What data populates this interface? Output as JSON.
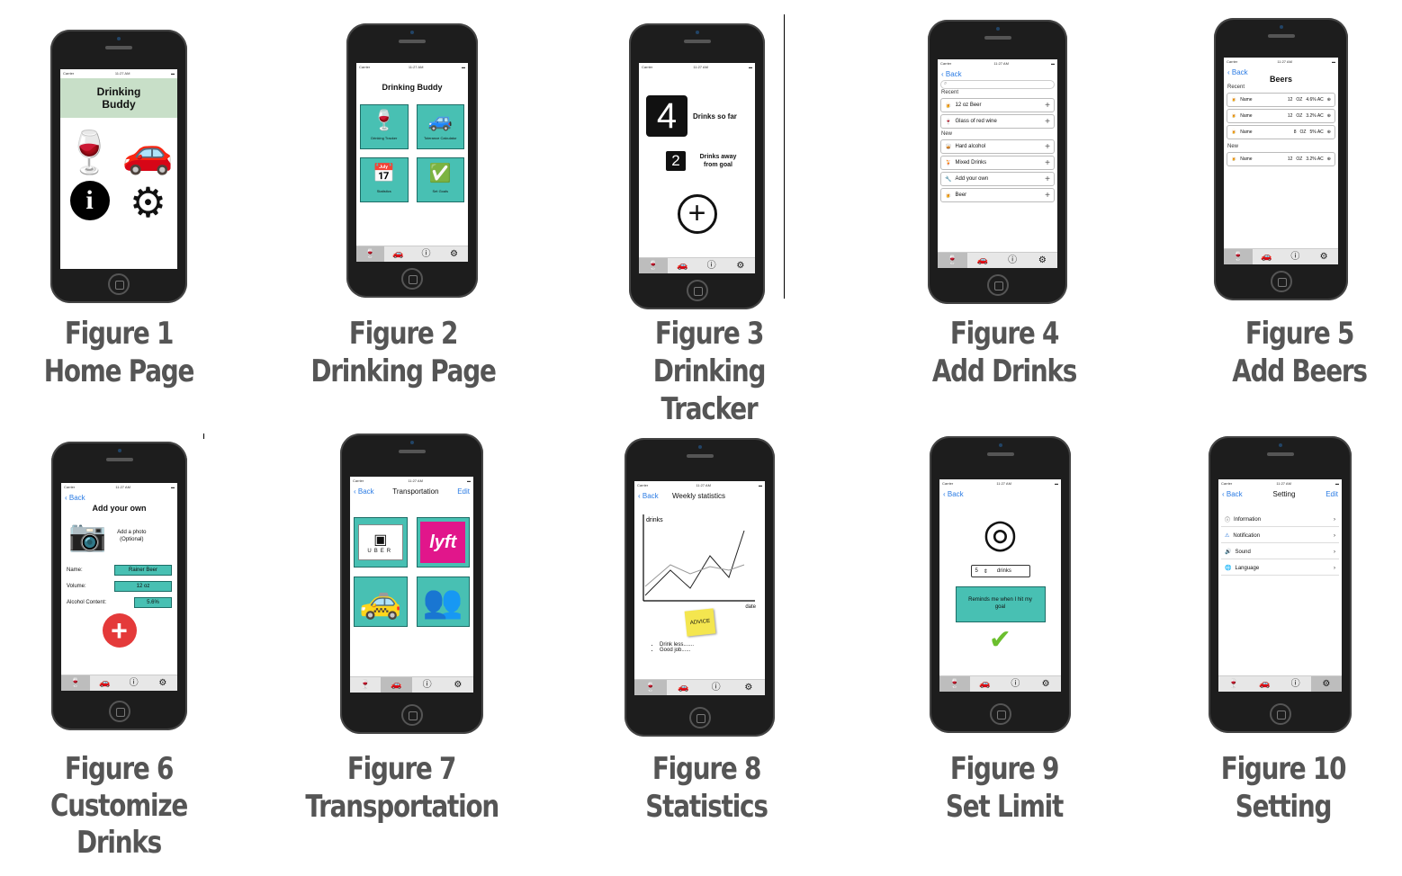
{
  "status": {
    "carrier": "Carrier",
    "time": "11:27 AM"
  },
  "back_label": "Back",
  "edit_label": "Edit",
  "figures": [
    {
      "num": "Figure 1",
      "title": "Home Page"
    },
    {
      "num": "Figure 2",
      "title": "Drinking Page"
    },
    {
      "num": "Figure 3",
      "title": "Drinking Tracker"
    },
    {
      "num": "Figure 4",
      "title": "Add Drinks"
    },
    {
      "num": "Figure 5",
      "title": "Add Beers"
    },
    {
      "num": "Figure 6",
      "title": "Customize Drinks"
    },
    {
      "num": "Figure 7",
      "title": "Transportation"
    },
    {
      "num": "Figure 8",
      "title": "Statistics"
    },
    {
      "num": "Figure 9",
      "title": "Set Limit"
    },
    {
      "num": "Figure 10",
      "title": "Setting"
    }
  ],
  "f1": {
    "header": "Drinking Buddy"
  },
  "f2": {
    "title": "Drinking Buddy",
    "tiles": [
      "Drinking Tracker",
      "Tolerance Calculator",
      "Statistics",
      "Set Goals"
    ]
  },
  "f3": {
    "count": "4",
    "count_label": "Drinks so far",
    "away": "2",
    "away_label": "Drinks away from goal"
  },
  "f4": {
    "recent_label": "Recent",
    "new_label": "New",
    "recent": [
      "12 oz Beer",
      "Glass of red wine"
    ],
    "new": [
      "Hard alcohol",
      "Mixed Drinks",
      "Add your own",
      "Beer"
    ]
  },
  "f5": {
    "title": "Beers",
    "recent_label": "Recent",
    "new_label": "New",
    "rows": [
      {
        "name": "Name",
        "oz": "12",
        "unit": "OZ",
        "abv": "4.6% AC"
      },
      {
        "name": "Name",
        "oz": "12",
        "unit": "OZ",
        "abv": "3.2% AC"
      },
      {
        "name": "Name",
        "oz": "8",
        "unit": "OZ",
        "abv": "5% AC"
      }
    ],
    "new_row": {
      "name": "Name",
      "oz": "12",
      "unit": "OZ",
      "abv": "3.2% AC"
    }
  },
  "f6": {
    "title": "Add your own",
    "photo": "Add a photo (Optional)",
    "name_label": "Name:",
    "name_val": "Rainer Beer",
    "vol_label": "Volume:",
    "vol_val": "12 oz",
    "alc_label": "Alcohol Content:",
    "alc_val": "5.6%"
  },
  "f7": {
    "title": "Transportation",
    "uber": "UBER",
    "lyft": "lyft"
  },
  "f8": {
    "title": "Weekly statistics",
    "ylabel": "drinks",
    "xlabel": "date",
    "note": "ADVICE",
    "bullets": [
      "Drink less.......",
      "Good job......"
    ]
  },
  "f9": {
    "value": "5",
    "unit": "drinks",
    "remind": "Reminds me when I hit my goal"
  },
  "f10": {
    "title": "Setting",
    "items": [
      "Information",
      "Notification",
      "Sound",
      "Language"
    ]
  }
}
